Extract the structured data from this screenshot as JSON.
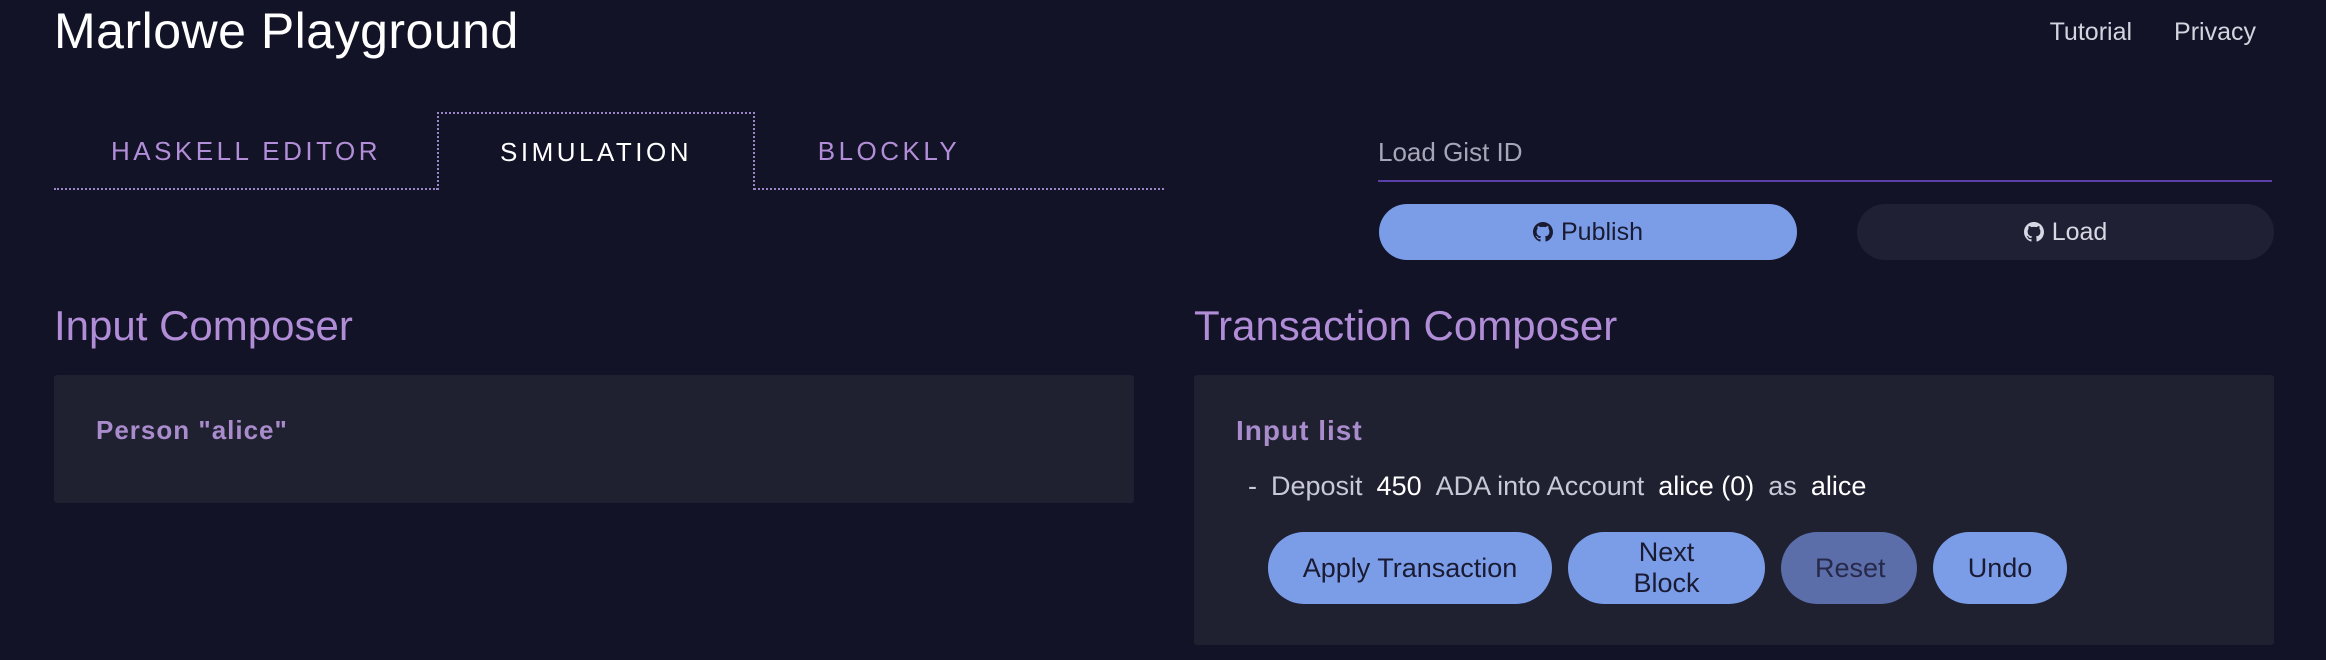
{
  "header": {
    "title": "Marlowe Playground",
    "nav": [
      "Tutorial",
      "Privacy"
    ]
  },
  "tabs": [
    {
      "label": "HASKELL EDITOR",
      "active": false
    },
    {
      "label": "SIMULATION",
      "active": true
    },
    {
      "label": "BLOCKLY",
      "active": false
    }
  ],
  "gist": {
    "placeholder": "Load Gist ID",
    "value": "",
    "publish_label": "Publish",
    "load_label": "Load",
    "icon": "github-icon"
  },
  "input_composer": {
    "title": "Input Composer",
    "person": "Person \"alice\""
  },
  "transaction_composer": {
    "title": "Transaction Composer",
    "input_list_title": "Input list",
    "input": {
      "dash": "-",
      "prefix": "Deposit",
      "amount": "450",
      "middle": "ADA into Account",
      "account": "alice (0)",
      "as": "as",
      "party": "alice"
    },
    "buttons": {
      "apply": "Apply Transaction",
      "next_block": "Next Block",
      "reset": "Reset",
      "undo": "Undo"
    }
  },
  "colors": {
    "background": "#121326",
    "accent_purple": "#b08dd6",
    "button_blue": "#7b9de8",
    "panel": "#1f2030"
  }
}
